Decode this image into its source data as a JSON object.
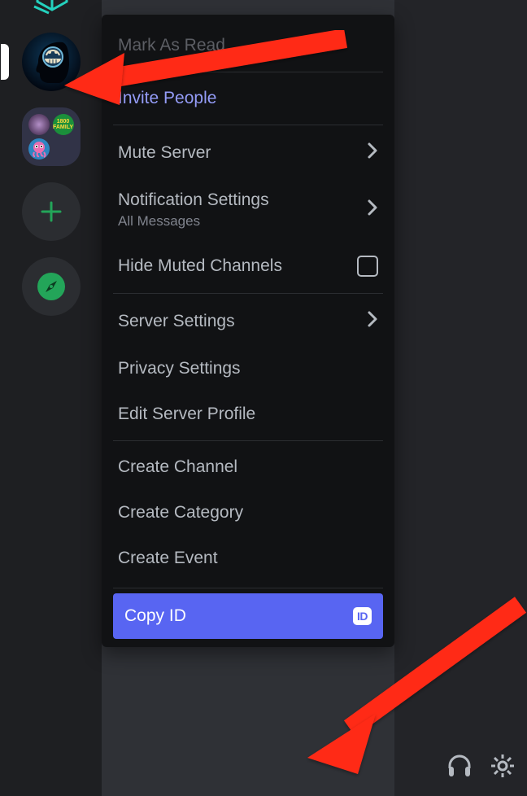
{
  "sidebar": {
    "folder_mini_label": "1800 FAMILY"
  },
  "menu": {
    "mark_read": "Mark As Read",
    "invite": "Invite People",
    "mute": "Mute Server",
    "notifications": {
      "label": "Notification Settings",
      "sub": "All Messages"
    },
    "hide_muted": "Hide Muted Channels",
    "server_settings": "Server Settings",
    "privacy": "Privacy Settings",
    "edit_profile": "Edit Server Profile",
    "create_channel": "Create Channel",
    "create_category": "Create Category",
    "create_event": "Create Event",
    "copy_id": "Copy ID",
    "id_badge": "ID"
  }
}
